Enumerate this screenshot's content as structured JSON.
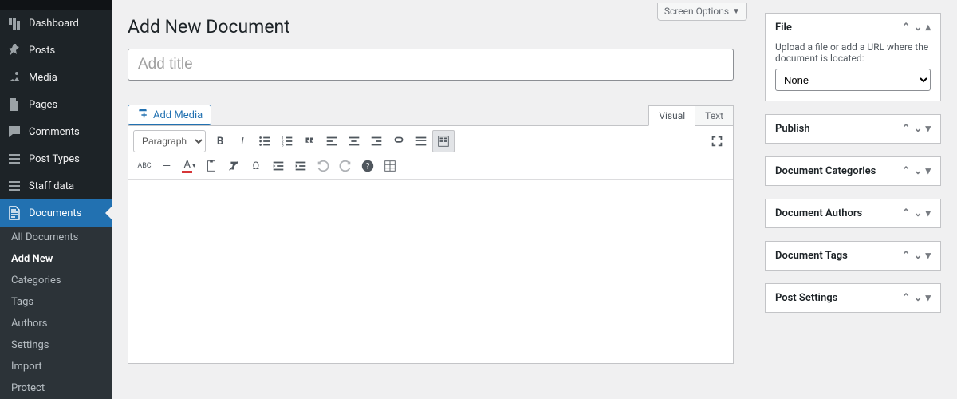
{
  "topbar": {
    "screen_options": "Screen Options"
  },
  "sidebar": {
    "items": [
      {
        "label": "Dashboard",
        "icon": "dashboard"
      },
      {
        "label": "Posts",
        "icon": "pin"
      },
      {
        "label": "Media",
        "icon": "media"
      },
      {
        "label": "Pages",
        "icon": "pages"
      },
      {
        "label": "Comments",
        "icon": "comment"
      },
      {
        "label": "Post Types",
        "icon": "list"
      },
      {
        "label": "Staff data",
        "icon": "list"
      },
      {
        "label": "Documents",
        "icon": "document"
      }
    ],
    "submenu": [
      {
        "label": "All Documents"
      },
      {
        "label": "Add New"
      },
      {
        "label": "Categories"
      },
      {
        "label": "Tags"
      },
      {
        "label": "Authors"
      },
      {
        "label": "Settings"
      },
      {
        "label": "Import"
      },
      {
        "label": "Protect"
      }
    ]
  },
  "page": {
    "title": "Add New Document",
    "title_placeholder": "Add title"
  },
  "editor": {
    "add_media": "Add Media",
    "tabs": {
      "visual": "Visual",
      "text": "Text"
    },
    "format_label": "Paragraph"
  },
  "metaboxes": {
    "file": {
      "title": "File",
      "hint": "Upload a file or add a URL where the document is located:",
      "select_value": "None"
    },
    "publish": {
      "title": "Publish"
    },
    "categories": {
      "title": "Document Categories"
    },
    "authors": {
      "title": "Document Authors"
    },
    "tags": {
      "title": "Document Tags"
    },
    "settings": {
      "title": "Post Settings"
    }
  }
}
